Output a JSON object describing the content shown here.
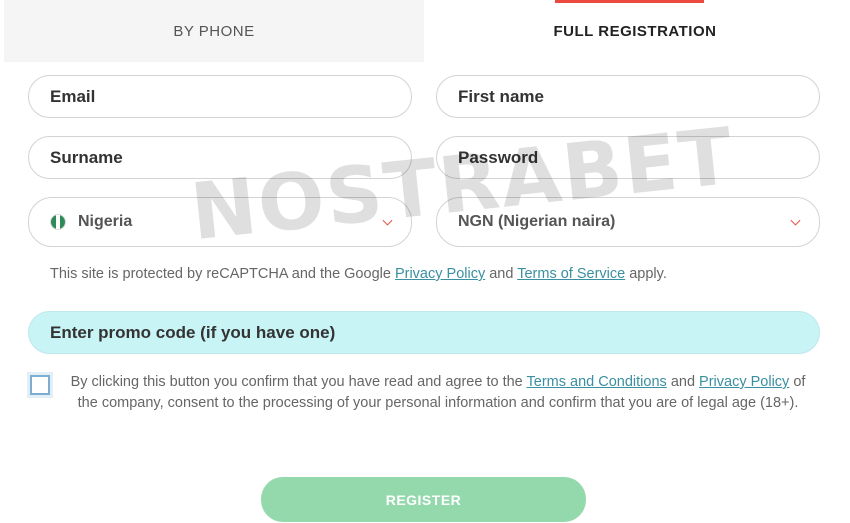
{
  "tabs": {
    "by_phone": "BY PHONE",
    "full_registration": "FULL REGISTRATION",
    "active": "full_registration"
  },
  "fields": {
    "email": "Email",
    "first_name": "First name",
    "surname": "Surname",
    "password": "Password",
    "country": "Nigeria",
    "currency": "NGN (Nigerian naira)"
  },
  "recaptcha": {
    "prefix": "This site is protected by reCAPTCHA and the Google",
    "privacy": "Privacy Policy",
    "and": "and",
    "terms": "Terms of Service",
    "suffix": "apply."
  },
  "promo": "Enter promo code (if you have one)",
  "consent": {
    "part1": "By clicking this button you confirm that you have read and agree to the",
    "terms": "Terms and Conditions",
    "and": "and",
    "privacy": "Privacy Policy",
    "part2": "of the company, consent to the processing of your personal information and confirm that you are of legal age (18+).",
    "checked": false
  },
  "register": "REGISTER",
  "watermark": "NOSTRABET",
  "colors": {
    "accent": "#e94a3d",
    "promo_bg": "#c8f4f6",
    "register_bg": "#93d9ab",
    "link": "#3a8fa0"
  },
  "icons": {
    "country_flag": "nigeria-flag-icon",
    "dropdown": "chevron-down-icon"
  }
}
